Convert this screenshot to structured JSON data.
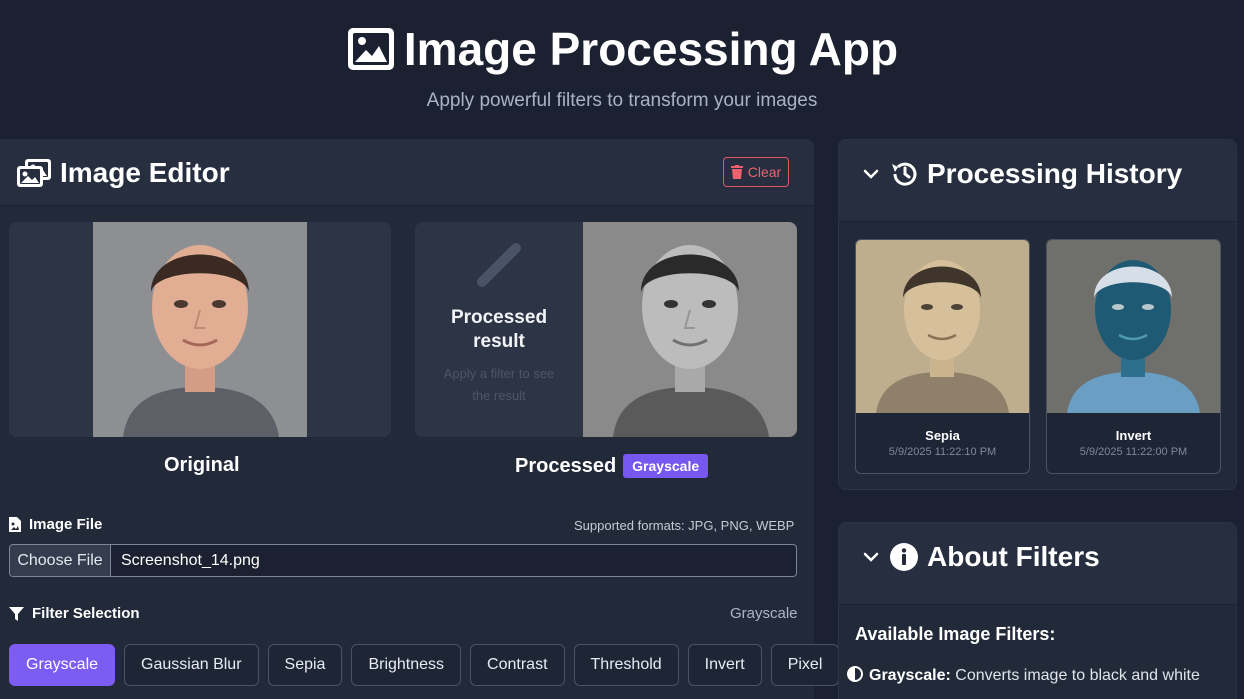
{
  "header": {
    "title": "Image Processing App",
    "subtitle": "Apply powerful filters to transform your images"
  },
  "editor": {
    "title": "Image Editor",
    "clear_label": "Clear",
    "placeholder_title": "Processed result",
    "placeholder_sub": "Apply a filter to see the result",
    "caption_original": "Original",
    "caption_processed": "Processed",
    "processed_badge": "Grayscale",
    "image_file_label": "Image File",
    "supported_formats": "Supported formats: JPG, PNG, WEBP",
    "choose_file_label": "Choose File",
    "file_name": "Screenshot_14.png",
    "filter_selection_label": "Filter Selection",
    "current_filter": "Grayscale",
    "filters": [
      "Grayscale",
      "Gaussian Blur",
      "Sepia",
      "Brightness",
      "Contrast",
      "Threshold",
      "Invert",
      "Pixel"
    ],
    "active_filter_index": 0
  },
  "history": {
    "title": "Processing History",
    "items": [
      {
        "name": "Sepia",
        "time": "5/9/2025 11:22:10 PM"
      },
      {
        "name": "Invert",
        "time": "5/9/2025 11:22:00 PM"
      }
    ]
  },
  "about": {
    "title": "About Filters",
    "heading": "Available Image Filters:",
    "first_item_name": "Grayscale:",
    "first_item_desc": "Converts image to black and white"
  },
  "colors": {
    "background": "#1b2130",
    "card": "#222a3a",
    "accent": "#7c5cf2",
    "danger": "#e25563"
  }
}
